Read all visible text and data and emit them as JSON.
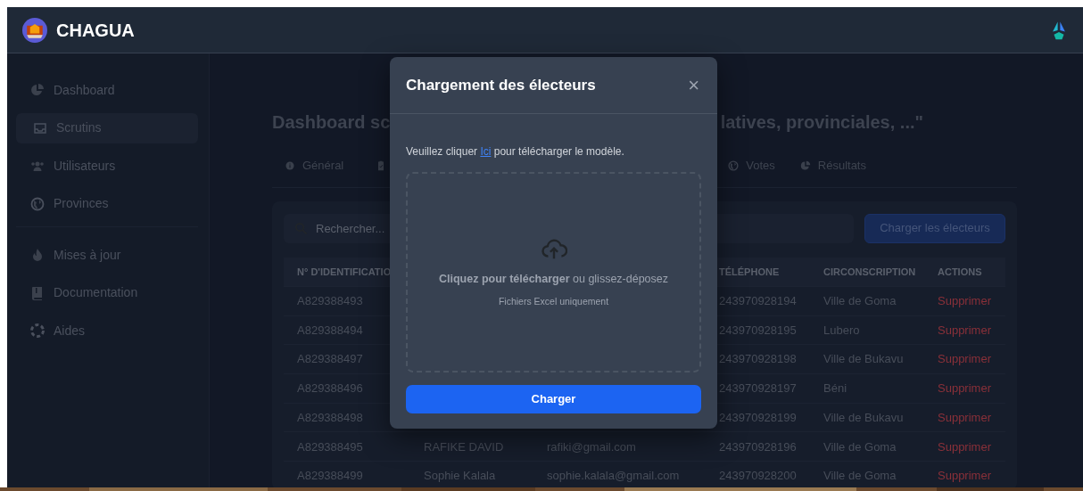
{
  "navbar": {
    "brand": "CHAGUA"
  },
  "sidebar": {
    "items": [
      {
        "label": "Dashboard",
        "selected": false
      },
      {
        "label": "Scrutins",
        "selected": true
      },
      {
        "label": "Utilisateurs",
        "selected": false
      },
      {
        "label": "Provinces",
        "selected": false
      },
      {
        "label": "Mises à jour",
        "selected": false
      },
      {
        "label": "Documentation",
        "selected": false
      },
      {
        "label": "Aides",
        "selected": false
      }
    ]
  },
  "page": {
    "title_start": "Dashboard sc",
    "title_end": "latives, provinciales, ...\"",
    "tabs": [
      {
        "kind": "labeled",
        "label": "Général"
      },
      {
        "kind": "covered"
      },
      {
        "kind": "labeled",
        "label": "Votes"
      },
      {
        "kind": "labeled",
        "label": "Résultats"
      }
    ],
    "search": {
      "placeholder": "Rechercher..."
    },
    "load_button": "Charger les électeurs",
    "table": {
      "header": {
        "id": "N° D'IDENTIFICATIO",
        "phone": "TÉLÉPHONE",
        "district": "CIRCONSCRIPTION",
        "action": "ACTIONS"
      },
      "rows": [
        {
          "id": "A829388493",
          "phone": "243970928194",
          "district": "Ville de Goma",
          "action": "Supprimer"
        },
        {
          "id": "A829388494",
          "phone": "243970928195",
          "district": "Lubero",
          "action": "Supprimer"
        },
        {
          "id": "A829388497",
          "phone": "243970928198",
          "district": "Ville de Bukavu",
          "action": "Supprimer"
        },
        {
          "id": "A829388496",
          "phone": "243970928197",
          "district": "Béni",
          "action": "Supprimer"
        },
        {
          "id": "A829388498",
          "phone": "243970928199",
          "district": "Ville de Bukavu",
          "action": "Supprimer"
        },
        {
          "id": "A829388495",
          "name": "RAFIKE DAVID",
          "email": "rafiki@gmail.com",
          "phone": "243970928196",
          "district": "Ville de Goma",
          "action": "Supprimer"
        },
        {
          "id": "A829388499",
          "name": "Sophie Kalala",
          "email": "sophie.kalala@gmail.com",
          "phone": "243970928200",
          "district": "Ville de Goma",
          "action": "Supprimer"
        }
      ]
    }
  },
  "modal": {
    "title": "Chargement des électeurs",
    "close": "×",
    "instruction_before": "Veuillez cliquer",
    "instruction_link": "Ici",
    "instruction_after": "pour télécharger le modèle.",
    "dropzone": {
      "text": "**Cliquez pour télécharger** ou glissez-déposez",
      "hint": "Fichiers Excel uniquement"
    },
    "submit": "Charger"
  }
}
